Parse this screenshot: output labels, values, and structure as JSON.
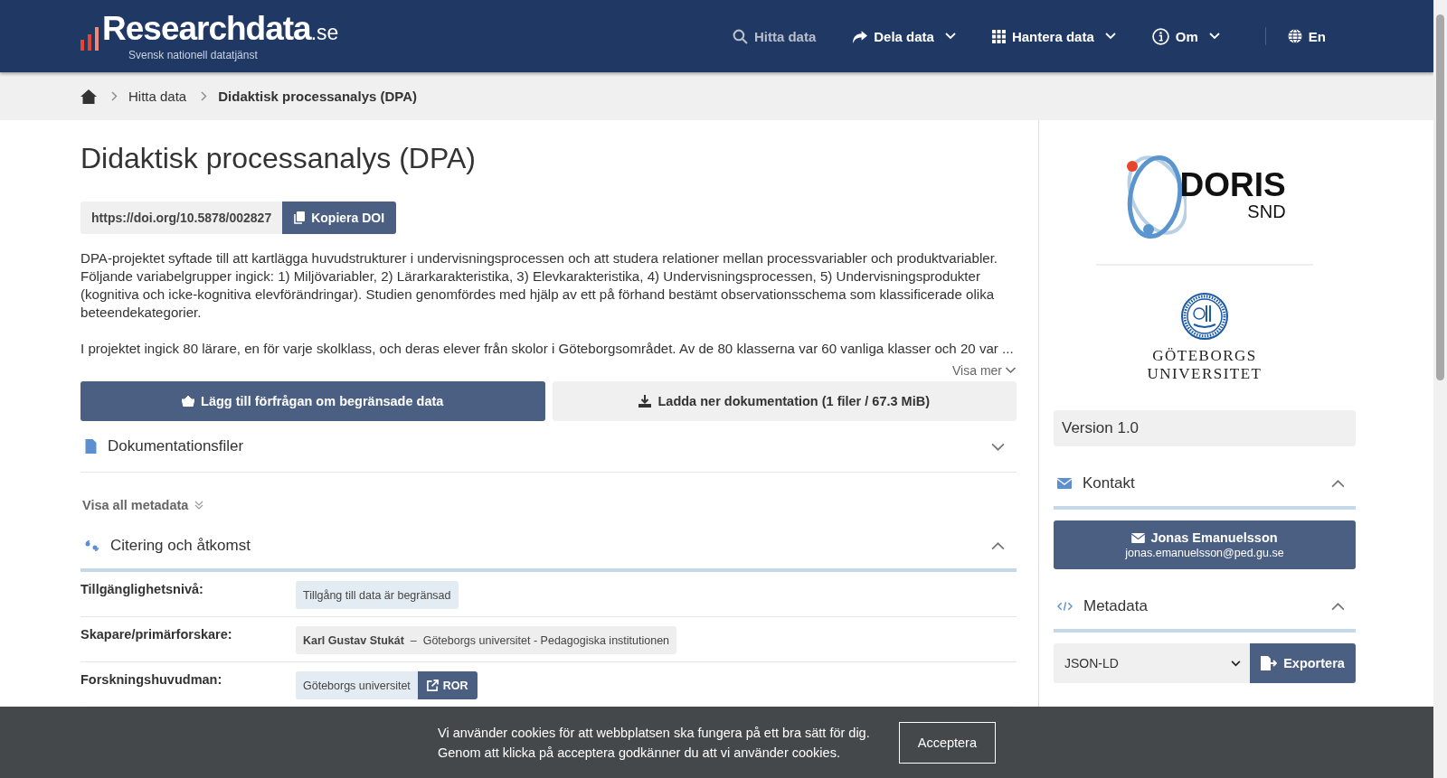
{
  "header": {
    "logo": {
      "name": "Researchdata",
      "tld": ".se",
      "tagline": "Svensk nationell datatjänst"
    },
    "nav": [
      {
        "label": "Hitta data",
        "kind": "search",
        "dropdown": false,
        "selected": true
      },
      {
        "label": "Dela data",
        "kind": "share",
        "dropdown": true,
        "selected": false
      },
      {
        "label": "Hantera data",
        "kind": "grid",
        "dropdown": true,
        "selected": false
      },
      {
        "label": "Om",
        "kind": "info",
        "dropdown": true,
        "selected": false
      }
    ],
    "language": "En"
  },
  "breadcrumb": [
    "Hitta data",
    "Didaktisk processanalys (DPA)"
  ],
  "title": "Didaktisk processanalys (DPA)",
  "doi": {
    "url": "https://doi.org/10.5878/002827",
    "button": "Kopiera DOI"
  },
  "description": [
    "DPA-projektet syftade till att kartlägga huvudstrukturer i undervisningsprocessen och att studera relationer mellan processvariabler och produktvariabler. Följande variabelgrupper ingick: 1) Miljövariabler, 2) Lärarkarakteristika, 3) Elevkarakteristika, 4) Undervisningsprocessen, 5) Undervisningsprodukter (kognitiva och icke-kognitiva elevförändringar). Studien genomfördes med hjälp av ett på förhand bestämt observationsschema som klassificerade olika beteendekategorier.",
    "I projektet ingick 80 lärare, en för varje skolklass, och deras elever från skolor i Göteborgsområdet. Av de 80 klasserna var 60 vanliga klasser och 20 var ..."
  ],
  "show_more": "Visa mer",
  "actions": [
    {
      "label": "Lägg till förfrågan om begränsade data",
      "kind": "primary"
    },
    {
      "label": "Ladda ner dokumentation (1 filer / 67.3 MiB)",
      "kind": "secondary"
    }
  ],
  "documentation": {
    "title": "Dokumentationsfiler",
    "expanded": false
  },
  "show_all_metadata": "Visa all metadata",
  "citation": {
    "title": "Citering och åtkomst",
    "expanded": true,
    "rows": [
      {
        "label": "Tillgänglighetsnivå:",
        "kind": "tag",
        "value": "Tillgång till data är begränsad"
      },
      {
        "label": "Skapare/primärforskare:",
        "kind": "person",
        "name": "Karl Gustav Stukát",
        "separator": "–",
        "affiliation": "Göteborgs universitet - Pedagogiska institutionen"
      },
      {
        "label": "Forskningshuvudman:",
        "kind": "org",
        "value": "Göteborgs universitet",
        "link": "ROR"
      }
    ]
  },
  "sidebar": {
    "doris_logo": {
      "name": "DORIS",
      "sub": "SND"
    },
    "university_logo": [
      "GÖTEBORGS",
      "UNIVERSITET"
    ],
    "version": "Version 1.0",
    "contact": {
      "title": "Kontakt",
      "expanded": true,
      "name": "Jonas Emanuelsson",
      "email": "jonas.emanuelsson@ped.gu.se"
    },
    "metadata": {
      "title": "Metadata",
      "expanded": true,
      "format": "JSON-LD",
      "button": "Exportera"
    }
  },
  "cookie": {
    "lines": [
      "Vi använder cookies för att webbplatsen ska fungera på ett bra sätt för dig.",
      "Genom att klicka på acceptera godkänner du att vi använder cookies."
    ],
    "button": "Acceptera"
  }
}
